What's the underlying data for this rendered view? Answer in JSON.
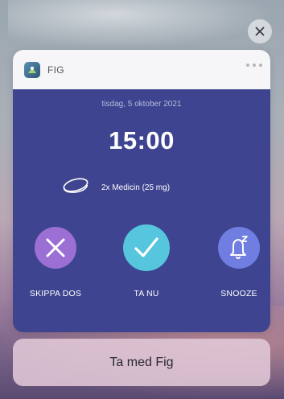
{
  "app": {
    "name": "FIG"
  },
  "notification": {
    "date": "tisdag, 5 oktober 2021",
    "time": "15:00",
    "medication": "2x Medicin (25 mg)"
  },
  "actions": {
    "skip_label": "SKIPPA DOS",
    "take_label": "TA NU",
    "snooze_label": "SNOOZE"
  },
  "footer": {
    "open_label": "Ta med Fig"
  },
  "colors": {
    "card_bg": "#3e448f",
    "skip": "#9b6fd3",
    "take": "#55c6dd",
    "snooze": "#6f7ee0"
  },
  "icons": [
    "close-icon",
    "app-icon",
    "more-icon",
    "pill-icon",
    "x-icon",
    "check-icon",
    "bell-snooze-icon"
  ]
}
